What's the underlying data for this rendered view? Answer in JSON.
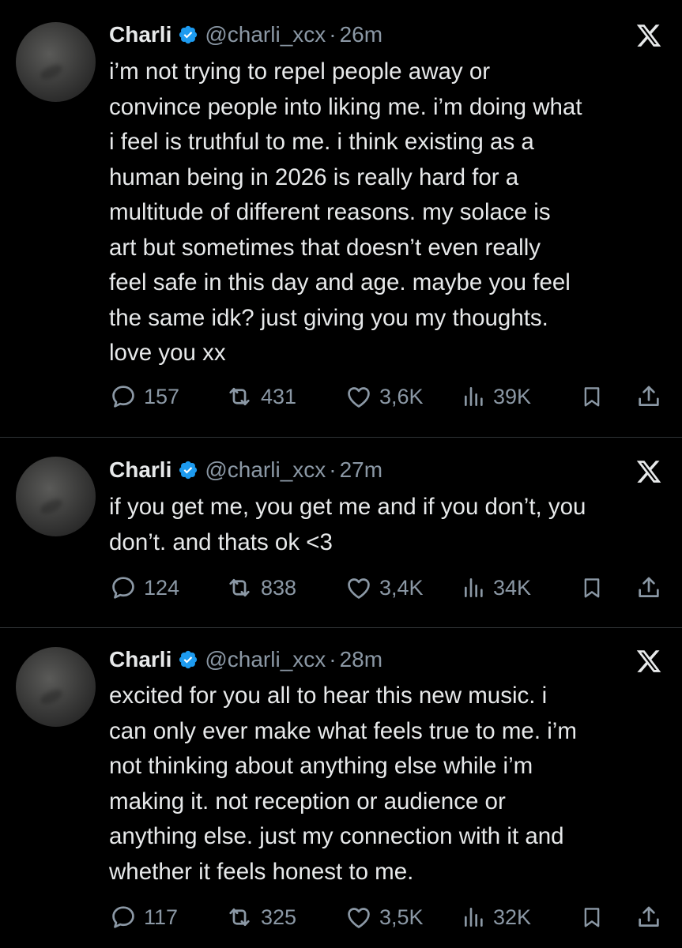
{
  "tweets": [
    {
      "name": "Charli",
      "handle": "@charli_xcx",
      "time": "26m",
      "text": "i’m not trying to repel people away or\nconvince people into liking me. i’m doing what\ni feel is truthful to me. i think existing as a\nhuman being in 2026 is really hard for a\nmultitude of different reasons. my solace is\nart but sometimes that doesn’t even really\nfeel safe in this day and age. maybe you feel\nthe same idk? just giving you my thoughts.\nlove you xx",
      "replies": "157",
      "reposts": "431",
      "likes": "3,6K",
      "views": "39K"
    },
    {
      "name": "Charli",
      "handle": "@charli_xcx",
      "time": "27m",
      "text": "if you get me, you get me and if you don’t, you\ndon’t. and thats ok <3",
      "replies": "124",
      "reposts": "838",
      "likes": "3,4K",
      "views": "34K"
    },
    {
      "name": "Charli",
      "handle": "@charli_xcx",
      "time": "28m",
      "text": "excited for you all to hear this new music. i\ncan only ever make what feels true to me. i’m\nnot thinking about anything else while i’m\nmaking it. not reception or audience or\nanything else. just my connection with it and\nwhether it feels honest to me.",
      "replies": "117",
      "reposts": "325",
      "likes": "3,5K",
      "views": "32K"
    }
  ],
  "icons": {
    "verified": "verified-badge-icon",
    "platform": "x-logo-icon",
    "reply": "reply-icon",
    "repost": "repost-icon",
    "like": "like-icon",
    "views": "views-icon",
    "bookmark": "bookmark-icon",
    "share": "share-icon"
  },
  "colors": {
    "background": "#000000",
    "text": "#e7e9ea",
    "secondary": "#8b98a5",
    "verified": "#1d9bf0",
    "divider": "#2f3336"
  }
}
